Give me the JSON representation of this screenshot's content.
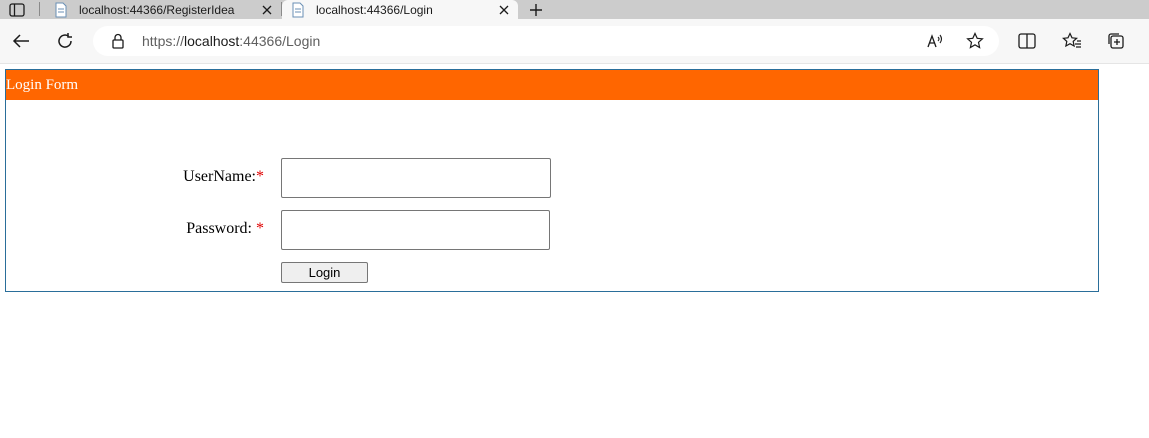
{
  "browser": {
    "tabs": [
      {
        "title": "localhost:44366/RegisterIdea",
        "active": false
      },
      {
        "title": "localhost:44366/Login",
        "active": true
      }
    ],
    "address": {
      "scheme": "https://",
      "host": "localhost",
      "rest": ":44366/Login"
    },
    "icons": {
      "tab_actions": "tab-actions-icon",
      "favicon": "page-icon",
      "close": "close-icon",
      "new_tab": "plus-icon",
      "back": "back-arrow-icon",
      "refresh": "refresh-icon",
      "lock": "lock-icon",
      "read_aloud": "read-aloud-icon",
      "favorite": "star-icon",
      "split_screen": "split-screen-icon",
      "favorites": "favorites-icon",
      "collections": "collections-icon"
    }
  },
  "login_form": {
    "header": "Login Form",
    "username_label": "UserName:",
    "password_label": "Password: ",
    "required_marker": "*",
    "username_value": "",
    "password_value": "",
    "login_button": "Login"
  },
  "colors": {
    "header_bg": "#ff6600",
    "header_text": "#ffffff",
    "panel_border": "#2a6e9a",
    "required": "#e00000"
  }
}
